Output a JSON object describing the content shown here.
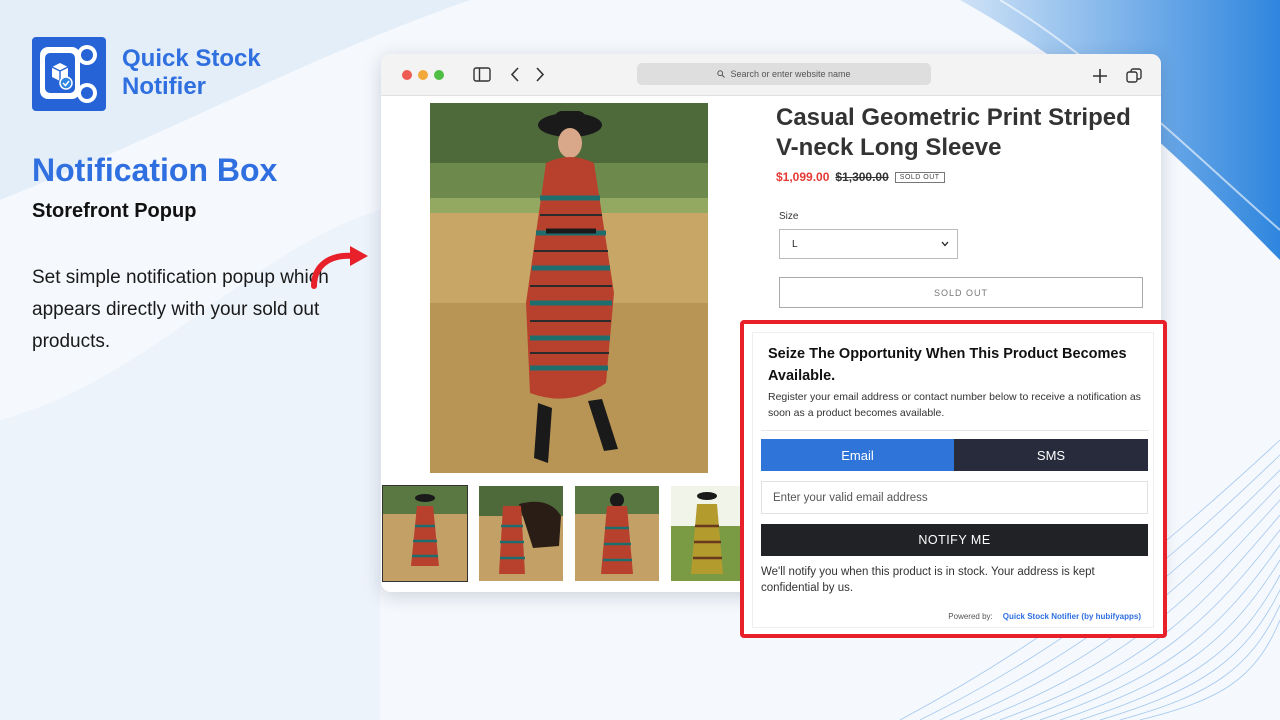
{
  "brand": {
    "name": "Quick Stock Notifier"
  },
  "left": {
    "heading": "Notification Box",
    "subheading": "Storefront Popup",
    "description": "Set simple notification popup which appears directly with your sold out products."
  },
  "browser": {
    "url_placeholder": "Search or enter website name"
  },
  "product": {
    "title": "Casual Geometric Print Striped V-neck Long Sleeve",
    "price_sale": "$1,099.00",
    "price_old": "$1,300.00",
    "badge": "SOLD OUT",
    "size_label": "Size",
    "size_value": "L",
    "soldout_button": "SOLD OUT"
  },
  "popup": {
    "title": "Seize The Opportunity When This Product Becomes Available.",
    "description": "Register your email address or contact number below to receive a notification as soon as a product becomes available.",
    "tabs": [
      {
        "label": "Email",
        "active": true
      },
      {
        "label": "SMS",
        "active": false
      }
    ],
    "email_placeholder": "Enter your valid email address",
    "notify_button": "NOTIFY ME",
    "note": "We'll notify you when this product is in stock. Your address is kept confidential by us.",
    "powered_label": "Powered by:",
    "powered_link": "Quick Stock Notifier (by hubifyapps)"
  },
  "colors": {
    "brand_blue": "#2f6fe0",
    "tab_email": "#2f74d8",
    "tab_sms": "#272b3c",
    "highlight_red": "#e8202a",
    "sale_red": "#e53935"
  }
}
